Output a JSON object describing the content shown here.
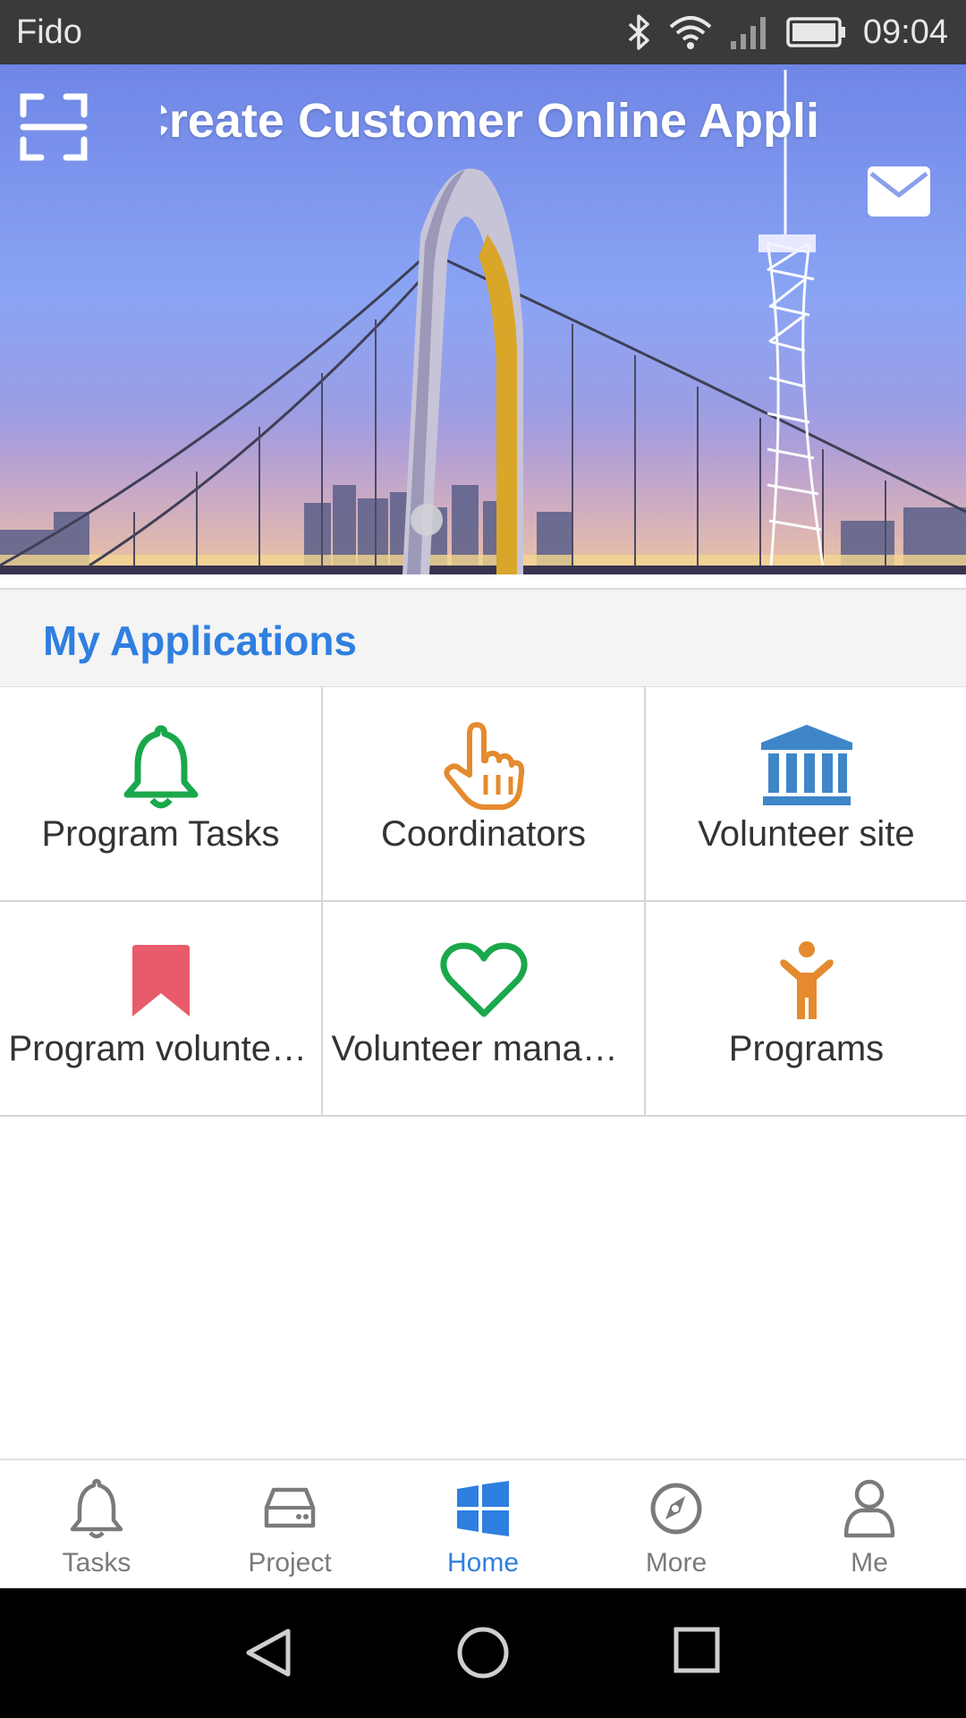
{
  "status_bar": {
    "carrier": "Fido",
    "time": "09:04",
    "icons": [
      "bluetooth-icon",
      "wifi-icon",
      "signal-icon",
      "battery-icon"
    ]
  },
  "banner": {
    "title": "Create Customer Online Application",
    "scan_icon": "scan-icon",
    "mail_icon": "mail-icon",
    "carousel_active_index": 0
  },
  "applications": {
    "section_title": "My Applications",
    "items": [
      {
        "label": "Program Tasks",
        "icon": "bell-icon",
        "color": "#1aa84b"
      },
      {
        "label": "Coordinators",
        "icon": "pointing-hand-icon",
        "color": "#e58a2e"
      },
      {
        "label": "Volunteer site",
        "icon": "institution-icon",
        "color": "#3f86c8"
      },
      {
        "label": "Program voluntеers",
        "icon": "bookmark-icon",
        "color": "#e85b6a"
      },
      {
        "label": "Volunteer management",
        "icon": "heart-icon",
        "color": "#1aa84b"
      },
      {
        "label": "Programs",
        "icon": "person-icon",
        "color": "#e58a2e"
      }
    ]
  },
  "bottom_nav": {
    "active": "Home",
    "accent_color": "#2f7fe0",
    "items": [
      {
        "label": "Tasks",
        "icon": "bell-icon"
      },
      {
        "label": "Project",
        "icon": "drive-icon"
      },
      {
        "label": "Home",
        "icon": "windows-icon"
      },
      {
        "label": "More",
        "icon": "compass-icon"
      },
      {
        "label": "Me",
        "icon": "user-icon"
      }
    ]
  },
  "system_nav": {
    "buttons": [
      "back-icon",
      "home-circle-icon",
      "recents-icon"
    ]
  }
}
